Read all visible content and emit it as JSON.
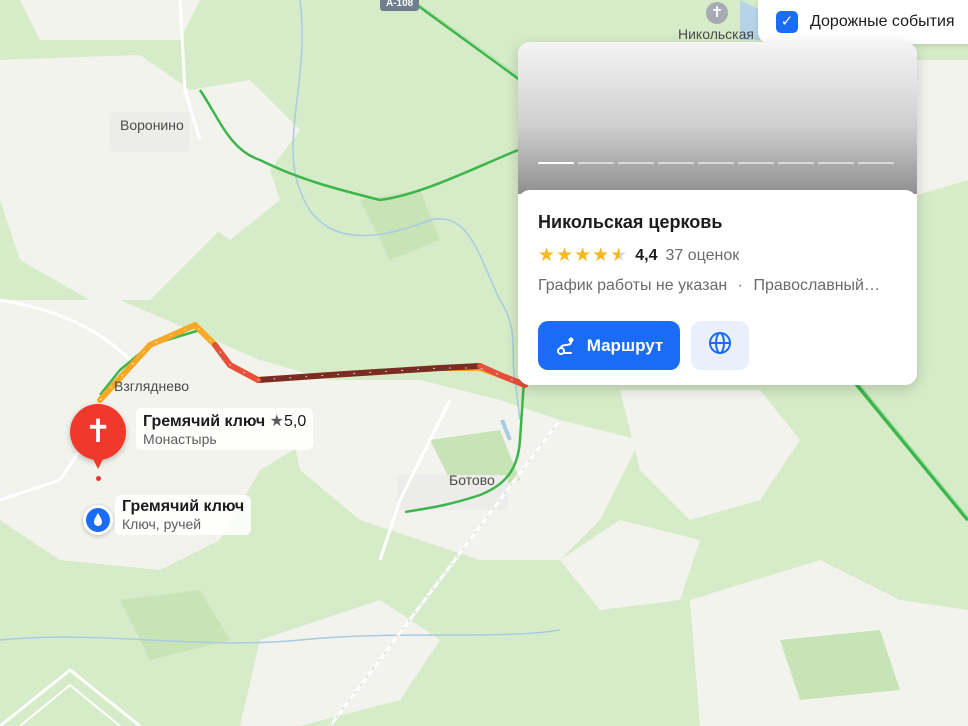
{
  "map": {
    "colors": {
      "forest": "#d6ecc8",
      "open_land": "#f3f3ee",
      "river": "#b5d4ea",
      "road_green": "#3cb64a",
      "route_orange": "#f7a825",
      "route_red": "#7a2c24"
    },
    "road_shield": "A-108",
    "place_labels": [
      "Никольская",
      "Воронино",
      "Взгляднево",
      "Ботово"
    ]
  },
  "traffic_toggle": {
    "label": "Дорожные события",
    "checked": true,
    "icon": "check-icon"
  },
  "card": {
    "photo_slides": 9,
    "photo_active_index": 0,
    "title": "Никольская церковь",
    "rating": "4,4",
    "stars_value": 4.4,
    "rating_count": "37 оценок",
    "hours": "График работы не указан",
    "separator": "·",
    "category": "Православный…",
    "route_button": "Маршрут",
    "route_icon": "route-icon",
    "web_icon": "globe-icon"
  },
  "poi_monastery": {
    "title": "Гремячий ключ",
    "star": "★",
    "rating": "5,0",
    "subtitle": "Монастырь",
    "icon": "cross-pin-icon"
  },
  "poi_spring": {
    "title": "Гремячий ключ",
    "subtitle": "Ключ, ручей",
    "icon": "water-drop-icon"
  }
}
